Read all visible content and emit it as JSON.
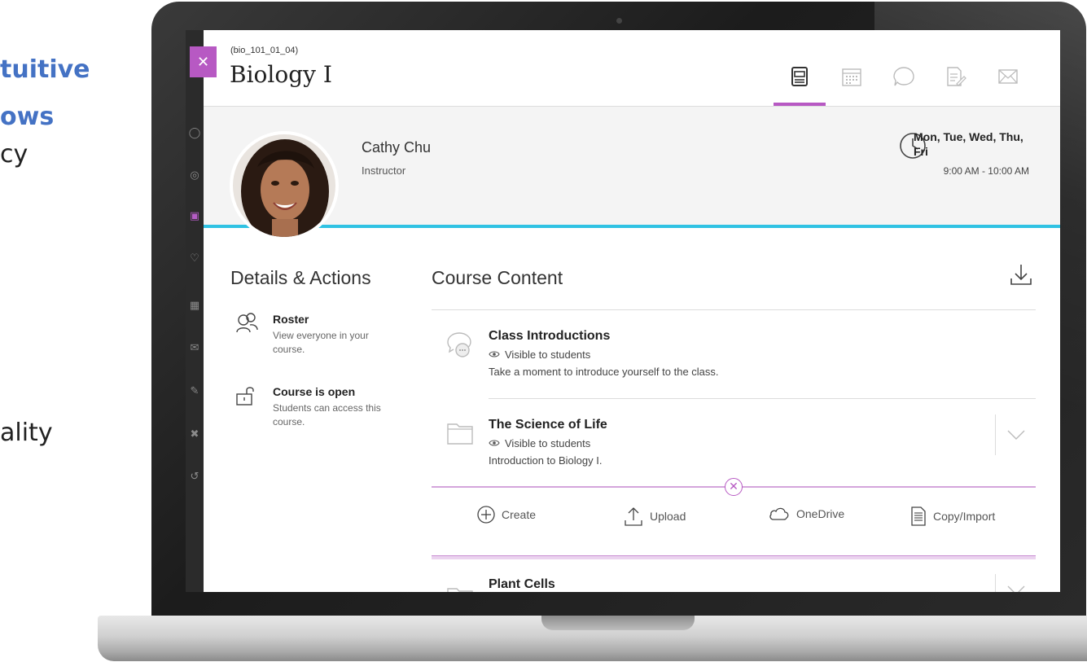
{
  "slide": {
    "line1": "tuitive",
    "line2": "ows",
    "line3": "cy",
    "line4": "ality"
  },
  "course": {
    "id": "(bio_101_01_04)",
    "title": "Biology I"
  },
  "top_nav": [
    {
      "icon": "course-content-icon",
      "active": true
    },
    {
      "icon": "calendar-icon",
      "active": false
    },
    {
      "icon": "discussions-icon",
      "active": false
    },
    {
      "icon": "gradebook-icon",
      "active": false
    },
    {
      "icon": "messages-icon",
      "active": false
    }
  ],
  "instructor": {
    "name": "Cathy Chu",
    "role": "Instructor"
  },
  "office_hours": {
    "days": "Mon, Tue, Wed, Thu, Fri",
    "time": "9:00 AM - 10:00 AM"
  },
  "details": {
    "title": "Details & Actions",
    "roster": {
      "title": "Roster",
      "desc": "View everyone in your course."
    },
    "access": {
      "title": "Course is open",
      "desc": "Students can access this course."
    }
  },
  "content": {
    "title": "Course Content",
    "items": [
      {
        "title": "Class Introductions",
        "visibility": "Visible to students",
        "desc": "Take a moment to introduce yourself to the class."
      },
      {
        "title": "The Science of Life",
        "visibility": "Visible to students",
        "desc": "Introduction to Biology I."
      },
      {
        "title": "Plant Cells"
      }
    ]
  },
  "add_options": {
    "create": "Create",
    "upload": "Upload",
    "onedrive": "OneDrive",
    "copy_import": "Copy/Import"
  },
  "colors": {
    "accent": "#b759c3",
    "banner_line": "#2fc2e3",
    "slide_heading": "#4472c4"
  }
}
